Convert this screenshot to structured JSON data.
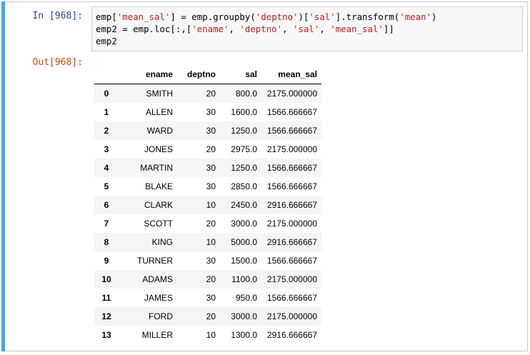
{
  "input_prompt": "In [968]:",
  "output_prompt": "Out[968]:",
  "code_lines": [
    [
      {
        "t": "emp[",
        "s": false
      },
      {
        "t": "'mean_sal'",
        "s": true
      },
      {
        "t": "] = emp.groupby(",
        "s": false
      },
      {
        "t": "'deptno'",
        "s": true
      },
      {
        "t": ")[",
        "s": false
      },
      {
        "t": "'sal'",
        "s": true
      },
      {
        "t": "].transform(",
        "s": false
      },
      {
        "t": "'mean'",
        "s": true
      },
      {
        "t": ")",
        "s": false
      }
    ],
    [
      {
        "t": "emp2 = emp.loc[:,[",
        "s": false
      },
      {
        "t": "'ename'",
        "s": true
      },
      {
        "t": ", ",
        "s": false
      },
      {
        "t": "'deptno'",
        "s": true
      },
      {
        "t": ", ",
        "s": false
      },
      {
        "t": "'sal'",
        "s": true
      },
      {
        "t": ", ",
        "s": false
      },
      {
        "t": "'mean_sal'",
        "s": true
      },
      {
        "t": "]]",
        "s": false
      }
    ],
    [
      {
        "t": "emp2",
        "s": false
      }
    ]
  ],
  "table": {
    "columns": [
      "",
      "ename",
      "deptno",
      "sal",
      "mean_sal"
    ],
    "rows": [
      [
        "0",
        "SMITH",
        "20",
        "800.0",
        "2175.000000"
      ],
      [
        "1",
        "ALLEN",
        "30",
        "1600.0",
        "1566.666667"
      ],
      [
        "2",
        "WARD",
        "30",
        "1250.0",
        "1566.666667"
      ],
      [
        "3",
        "JONES",
        "20",
        "2975.0",
        "2175.000000"
      ],
      [
        "4",
        "MARTIN",
        "30",
        "1250.0",
        "1566.666667"
      ],
      [
        "5",
        "BLAKE",
        "30",
        "2850.0",
        "1566.666667"
      ],
      [
        "6",
        "CLARK",
        "10",
        "2450.0",
        "2916.666667"
      ],
      [
        "7",
        "SCOTT",
        "20",
        "3000.0",
        "2175.000000"
      ],
      [
        "8",
        "KING",
        "10",
        "5000.0",
        "2916.666667"
      ],
      [
        "9",
        "TURNER",
        "30",
        "1500.0",
        "1566.666667"
      ],
      [
        "10",
        "ADAMS",
        "20",
        "1100.0",
        "2175.000000"
      ],
      [
        "11",
        "JAMES",
        "30",
        "950.0",
        "1566.666667"
      ],
      [
        "12",
        "FORD",
        "20",
        "3000.0",
        "2175.000000"
      ],
      [
        "13",
        "MILLER",
        "10",
        "1300.0",
        "2916.666667"
      ]
    ]
  },
  "colors": {
    "accent": "#42a5f5",
    "in_prompt": "#303f9f",
    "out_prompt": "#d84315",
    "string": "#ba2121",
    "stripe": "#f5f5f5"
  }
}
